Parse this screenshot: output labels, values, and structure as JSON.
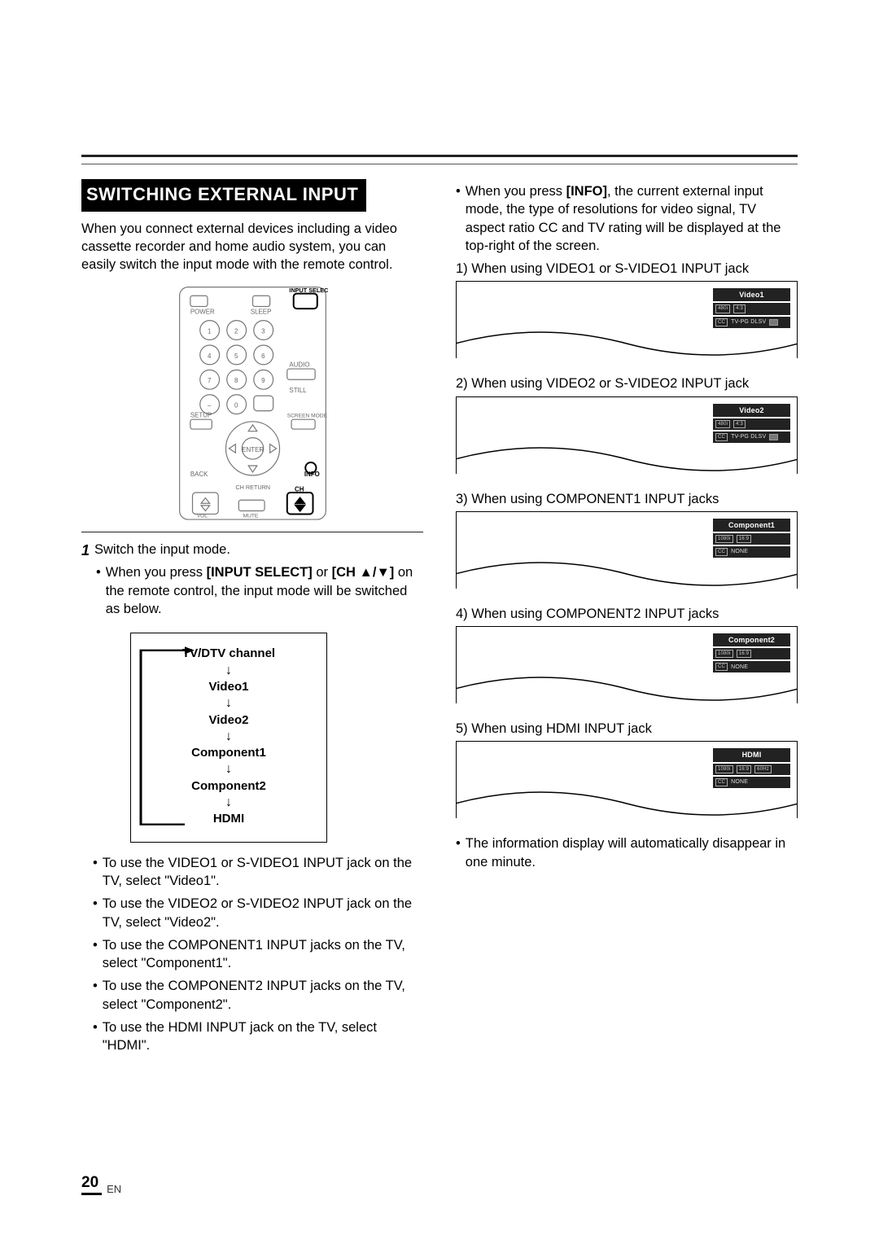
{
  "page": {
    "number": "20",
    "lang": "EN"
  },
  "heading": "SWITCHING EXTERNAL INPUT",
  "intro": "When you connect external devices including a video cassette recorder and home audio system, you can easily switch the input mode with the remote control.",
  "remote": {
    "labels": {
      "power": "POWER",
      "sleep": "SLEEP",
      "input_select": "INPUT SELECT",
      "audio": "AUDIO",
      "still": "STILL",
      "setup": "SETUP",
      "screen_mode": "SCREEN MODE",
      "enter": "ENTER",
      "back": "BACK",
      "info": "INFO",
      "ch_return": "CH RETURN",
      "vol": "VOL.",
      "mute": "MUTE",
      "ch": "CH"
    },
    "digits": [
      "1",
      "2",
      "3",
      "4",
      "5",
      "6",
      "7",
      "8",
      "9",
      "0"
    ]
  },
  "step1": {
    "num": "1",
    "text": "Switch the input mode.",
    "press_pre": "When you press ",
    "press_bold1": "[INPUT SELECT]",
    "press_mid": " or ",
    "press_bold2": "[CH ",
    "press_arrows": "▲/▼]",
    "press_post": " on the remote control, the input mode will be switched as below."
  },
  "flow": {
    "items": [
      "TV/DTV channel",
      "Video1",
      "Video2",
      "Component1",
      "Component2",
      "HDMI"
    ]
  },
  "use": [
    "To use the VIDEO1 or S-VIDEO1 INPUT jack on the TV, select \"Video1\".",
    "To use the VIDEO2 or S-VIDEO2 INPUT jack on the TV, select \"Video2\".",
    "To use the COMPONENT1 INPUT jacks on the TV, select \"Component1\".",
    "To use the COMPONENT2 INPUT jacks on the TV, select \"Component2\".",
    "To use the HDMI INPUT jack on the TV, select \"HDMI\"."
  ],
  "right_top": {
    "pre": "When you press ",
    "bold": "[INFO]",
    "post": ", the current external input mode, the type of resolutions for video signal, TV aspect ratio CC and TV rating will be displayed at the top-right of the screen."
  },
  "screens": [
    {
      "caption": "1) When using VIDEO1 or S-VIDEO1 INPUT jack",
      "title": "Video1",
      "res1": "480i",
      "res2": "4:3",
      "rating_prefix": "CC",
      "rating": "TV-PG DLSV"
    },
    {
      "caption": "2) When using VIDEO2 or S-VIDEO2 INPUT jack",
      "title": "Video2",
      "res1": "480i",
      "res2": "4:3",
      "rating_prefix": "CC",
      "rating": "TV-PG DLSV"
    },
    {
      "caption": "3) When using COMPONENT1 INPUT jacks",
      "title": "Component1",
      "res1": "1080i",
      "res2": "16:9",
      "rating_prefix": "CC",
      "rating": "NONE"
    },
    {
      "caption": "4) When using COMPONENT2 INPUT jacks",
      "title": "Component2",
      "res1": "1080i",
      "res2": "16:9",
      "rating_prefix": "CC",
      "rating": "NONE"
    },
    {
      "caption": "5) When using HDMI INPUT jack",
      "title": "HDMI",
      "res1": "1080i",
      "res2": "16:9",
      "res3": "60Hz",
      "rating_prefix": "CC",
      "rating": "NONE"
    }
  ],
  "right_bottom": "The information display will automatically disappear in one minute."
}
